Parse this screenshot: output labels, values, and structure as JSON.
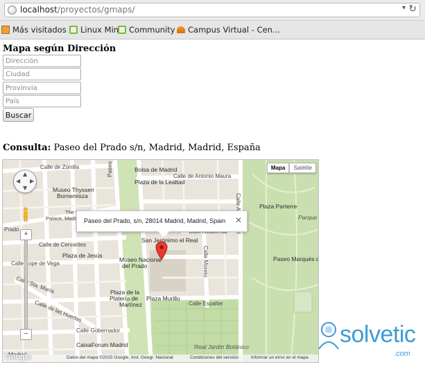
{
  "browser": {
    "url_host": "localhost",
    "url_path": "/proyectos/gmaps/",
    "bookmarks": [
      {
        "label": "Más visitados",
        "icon": "folder-icon"
      },
      {
        "label": "Linux Mint",
        "icon": "mint-icon"
      },
      {
        "label": "Community",
        "icon": "mint-icon"
      },
      {
        "label": "Campus Virtual - Cen...",
        "icon": "moodle-icon"
      }
    ]
  },
  "page": {
    "title": "Mapa según Dirección",
    "fields": {
      "direccion": "Dirección",
      "ciudad": "Ciudad",
      "provincia": "Provinvia",
      "pais": "País"
    },
    "search_button": "Buscar",
    "consulta_label": "Consulta:",
    "consulta_value": "Paseo del Prado s/n, Madrid, Madrid, España"
  },
  "map": {
    "type_buttons": {
      "map": "Mapa",
      "satellite": "Satélite"
    },
    "infowindow": "Paseo del Prado, s/n, 28014 Madrid, Madrid, Spain",
    "zoom_in": "+",
    "zoom_out": "−",
    "labels": {
      "calle_zorrilla": "Calle de Zorrilla",
      "prado_vert": "Paseo",
      "bolsa": "Bolsa de Madrid",
      "plaza_lealtad": "Plaza de la Lealtad",
      "antonio_maura": "Calle de Antonio Maura",
      "museo_thyssen": "Museo Thyssen",
      "bornemisza": "Bornemisza",
      "westin_1": "The Westin",
      "westin_2": "Palace, Madrid",
      "alfonso_xii": "Calle Alfonso XII",
      "plaza_parterre": "Plaza Parterre",
      "parque_o": "Parque o",
      "calle_academia": "Calle Academia",
      "san_jeronimo": "San Jerónimo el Real",
      "prado_left": "Prado",
      "cervantes": "Calle de Cervantes",
      "plaza_jesus": "Plaza de Jesús",
      "lope_vega": "Calle Lope de Vega",
      "museo_prado_1": "Museo Nacional",
      "museo_prado_2": "del Prado",
      "calle_moreto": "Calle Moreto",
      "paseo_marques": "Paseo Marqués de",
      "sta_maria": "Calle Sta. María",
      "plaza_platerias_1": "Plaza de la",
      "plaza_platerias_2": "Platería de",
      "plaza_platerias_3": "Martínez",
      "plaza_murillo": "Plaza Murillo",
      "huertas": "Calle de las Huertas",
      "calle_espalter": "Calle Espalter",
      "calle_gobernador": "Calle Gobernador",
      "caixaforum": "CaixaForum Madrid",
      "jardin_botanico": "Real Jardín Botánico",
      "madrid": "Madrid"
    },
    "footer": {
      "data": "Datos del mapa ©2015 Google, Inst. Geogr. Nacional",
      "terms": "Condiciones del servicio",
      "report": "Informar un error en el mapa"
    },
    "google_logo": "Google"
  },
  "watermark": {
    "brand": "solvetic",
    "suffix": ".com"
  }
}
